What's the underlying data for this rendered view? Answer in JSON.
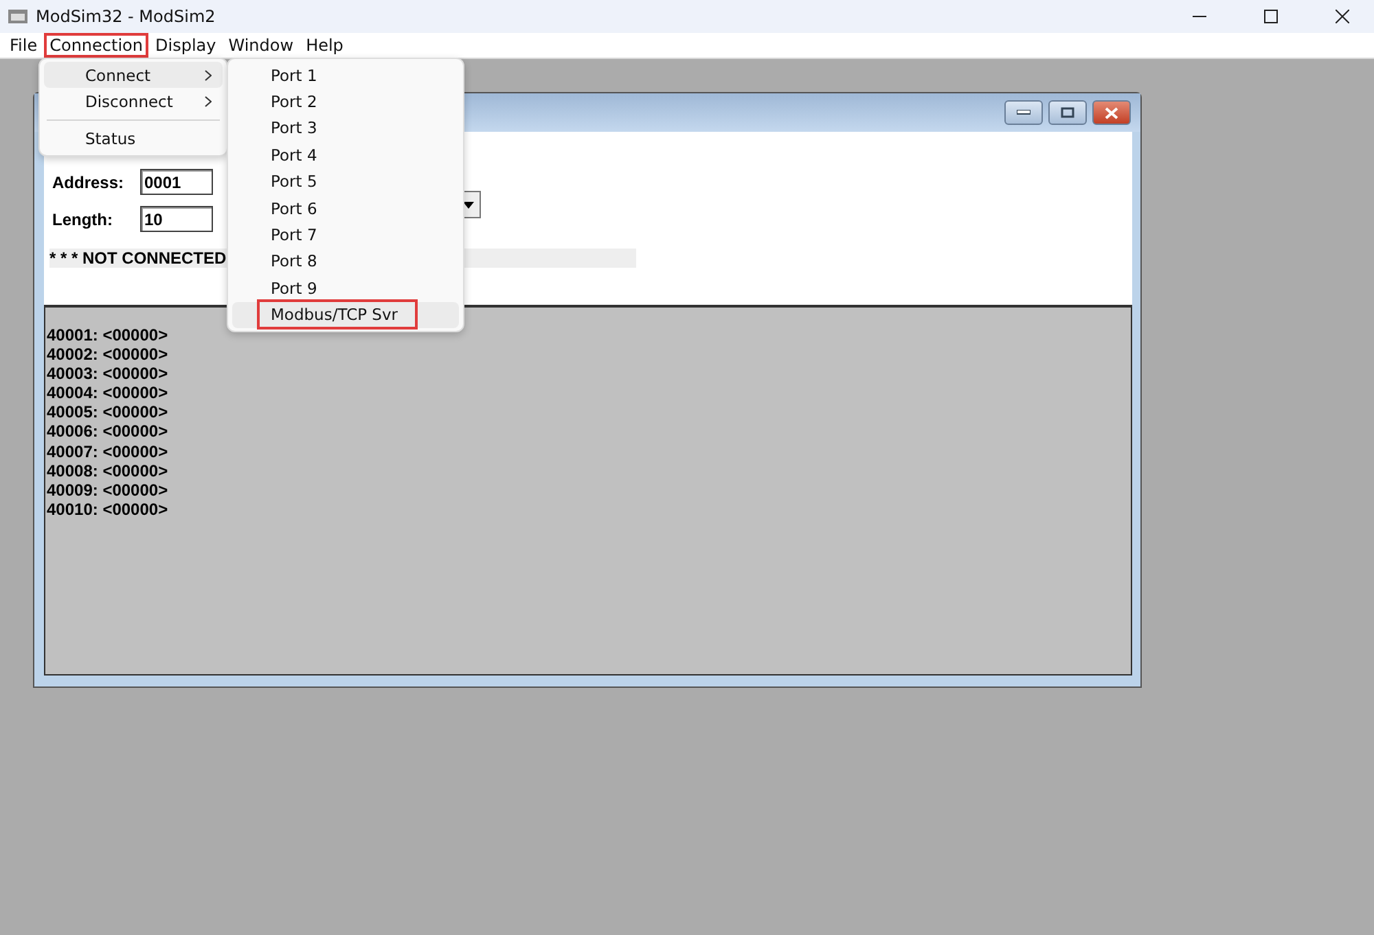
{
  "window": {
    "title": "ModSim32 - ModSim2"
  },
  "menu_bar": [
    {
      "label": "File",
      "annotated": false
    },
    {
      "label": "Connection",
      "annotated": true
    },
    {
      "label": "Display",
      "annotated": false
    },
    {
      "label": "Window",
      "annotated": false
    },
    {
      "label": "Help",
      "annotated": false
    }
  ],
  "connection_menu": [
    {
      "kind": "item",
      "label": "Connect",
      "submenu": true,
      "selected": true
    },
    {
      "kind": "item",
      "label": "Disconnect",
      "submenu": true,
      "selected": false
    },
    {
      "kind": "separator"
    },
    {
      "kind": "item",
      "label": "Status",
      "submenu": false,
      "selected": false
    }
  ],
  "connect_submenu": [
    {
      "label": "Port 1",
      "selected": false,
      "annotated": false
    },
    {
      "label": "Port 2",
      "selected": false,
      "annotated": false
    },
    {
      "label": "Port 3",
      "selected": false,
      "annotated": false
    },
    {
      "label": "Port 4",
      "selected": false,
      "annotated": false
    },
    {
      "label": "Port 5",
      "selected": false,
      "annotated": false
    },
    {
      "label": "Port 6",
      "selected": false,
      "annotated": false
    },
    {
      "label": "Port 7",
      "selected": false,
      "annotated": false
    },
    {
      "label": "Port 8",
      "selected": false,
      "annotated": false
    },
    {
      "label": "Port 9",
      "selected": false,
      "annotated": false
    },
    {
      "label": "Modbus/TCP Svr",
      "selected": true,
      "annotated": true
    }
  ],
  "child_window": {
    "fields": [
      {
        "label": "Address:",
        "value": "0001"
      },
      {
        "label": "Length:",
        "value": "10"
      }
    ],
    "status": "* * * NOT CONNECTED",
    "registers": [
      "40001: <00000>",
      "40002: <00000>",
      "40003: <00000>",
      "40004: <00000>",
      "40005: <00000>",
      "40006: <00000>",
      "40007: <00000>",
      "40008: <00000>",
      "40009: <00000>",
      "40010: <00000>"
    ]
  }
}
